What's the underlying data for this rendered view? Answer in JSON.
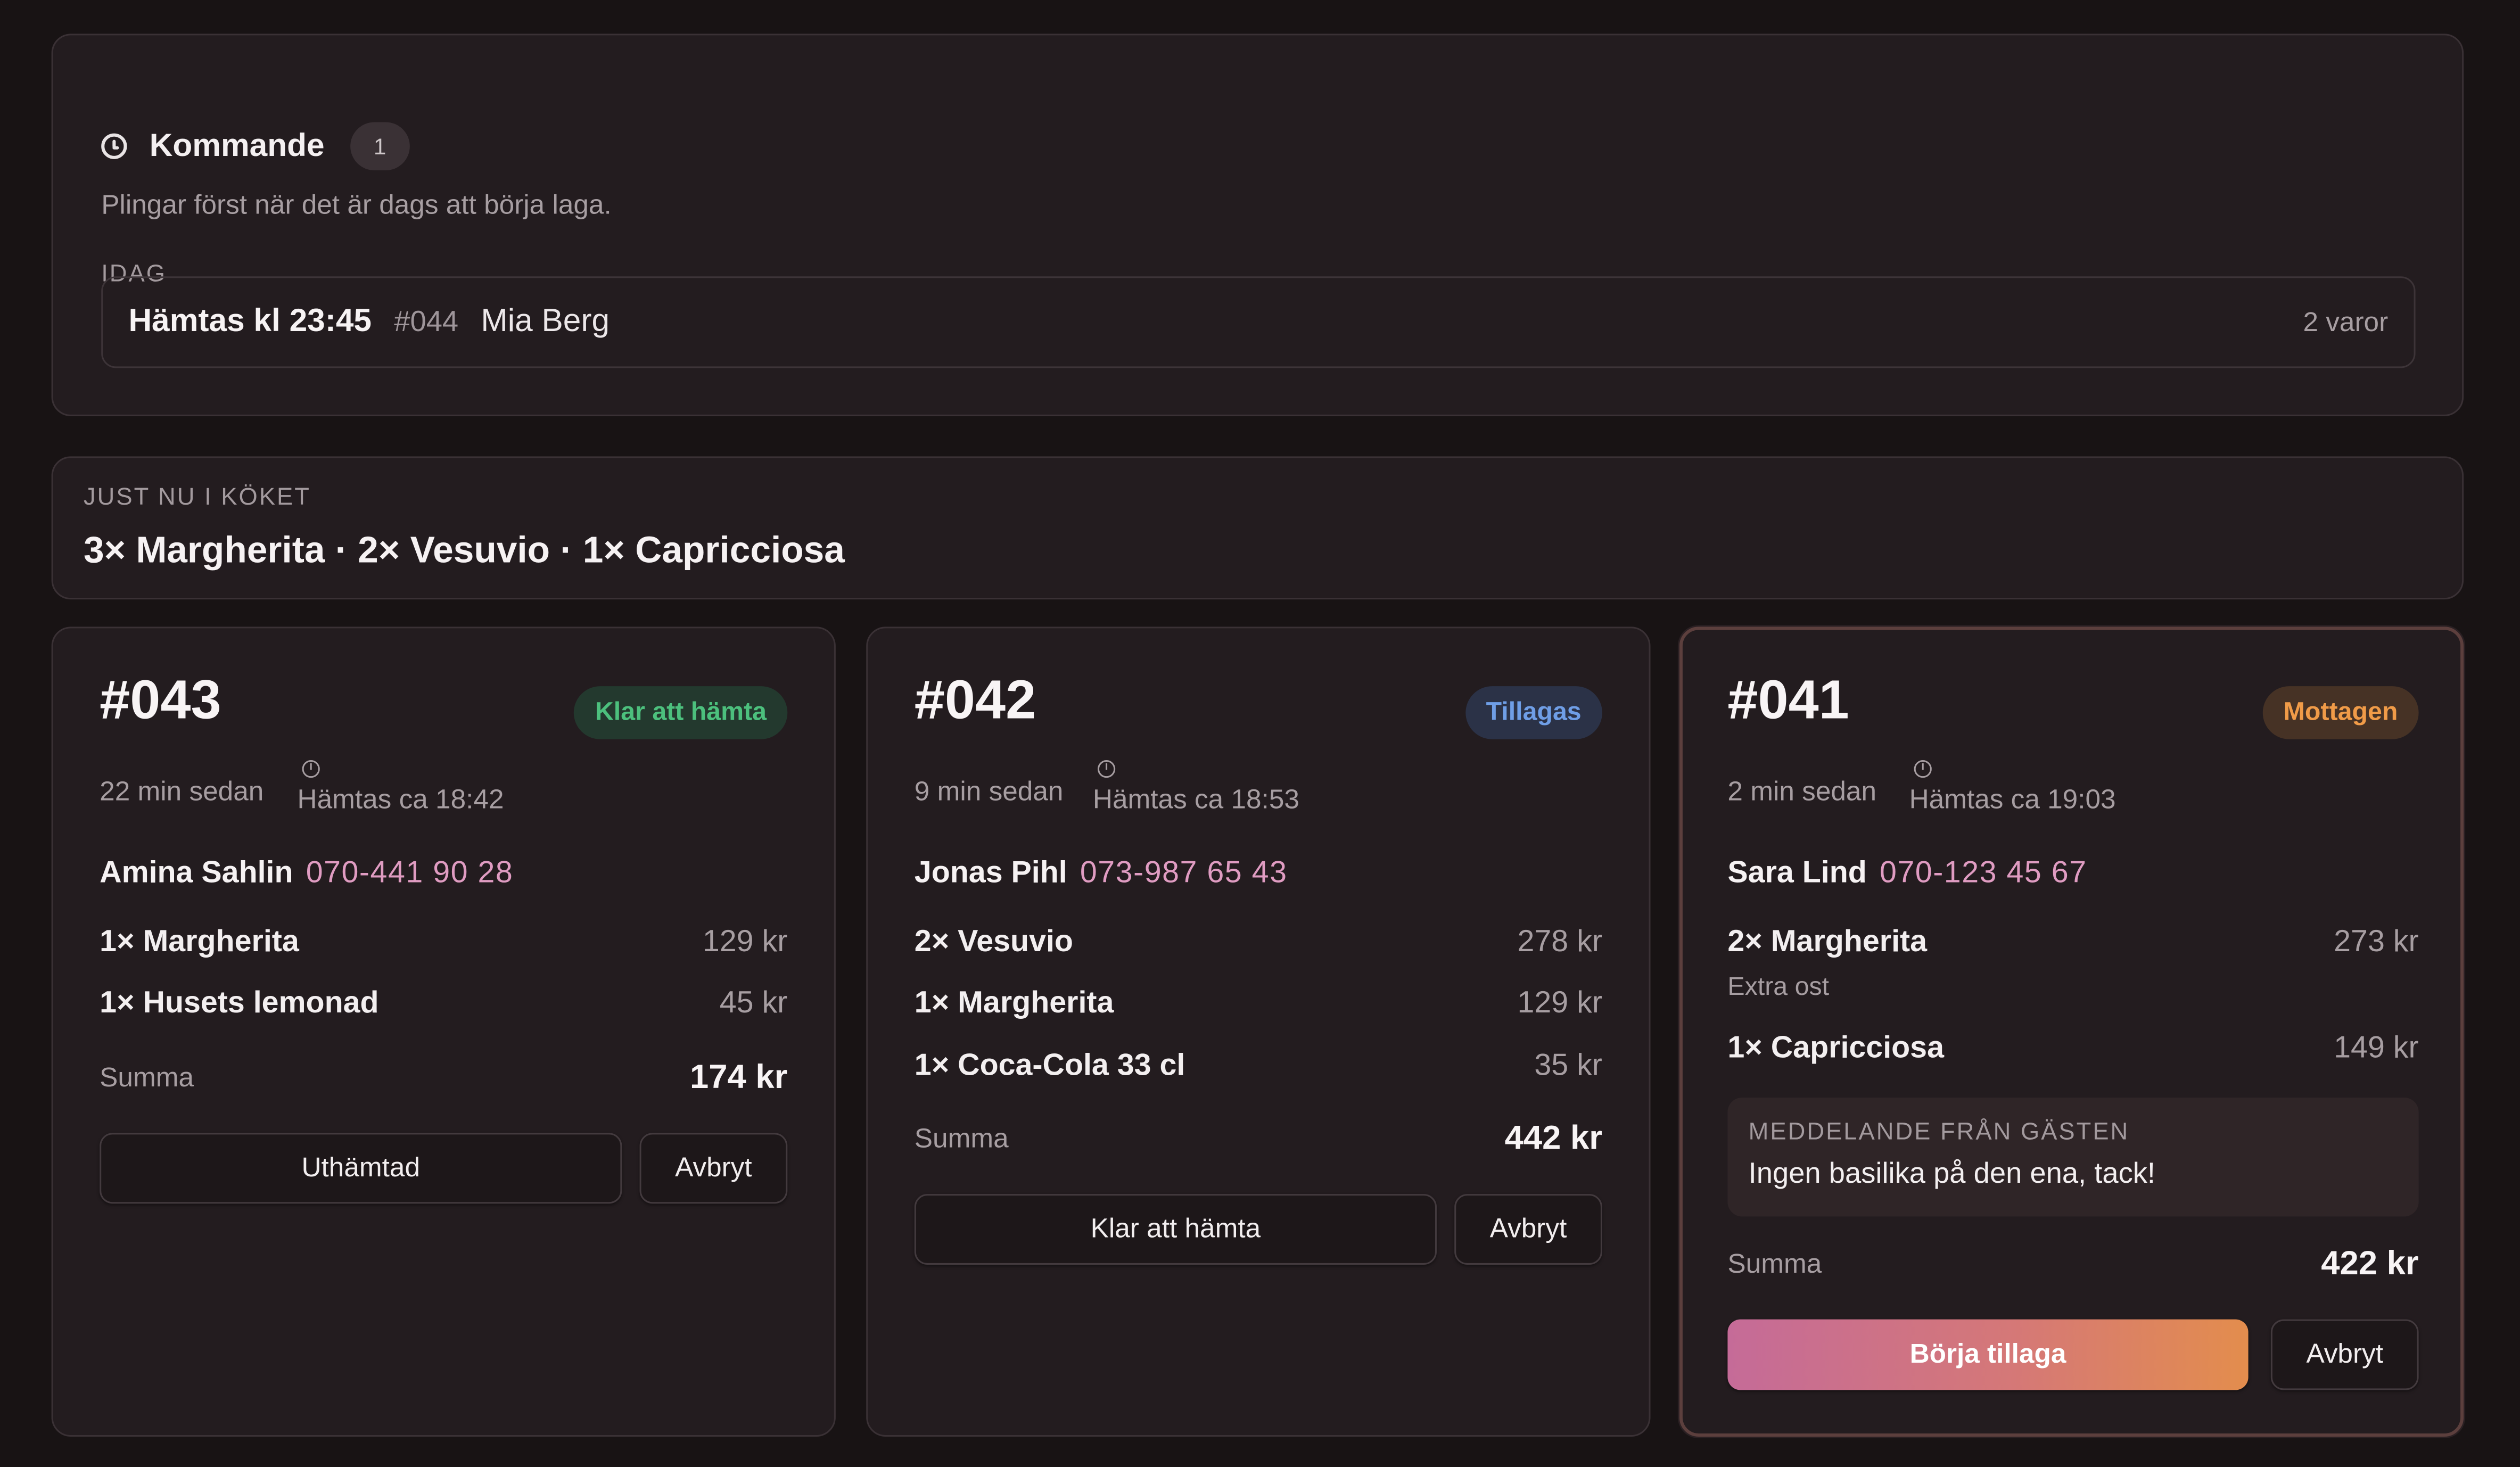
{
  "upcoming": {
    "title": "Kommande",
    "count": "1",
    "subtitle": "Plingar först när det är dags att börja laga.",
    "day_label": "IDAG",
    "orders": [
      {
        "pickup": "Hämtas kl 23:45",
        "id": "#044",
        "name": "Mia Berg",
        "items": "2 varor"
      }
    ]
  },
  "now_in_kitchen": {
    "label": "JUST NU I KÖKET",
    "summary": "3× Margherita · 2× Vesuvio · 1× Capricciosa"
  },
  "orders": [
    {
      "number": "#043",
      "status": "Klar att hämta",
      "status_color": "#4cc07d",
      "ago": "22 min sedan",
      "pickup": "Hämtas ca 18:42",
      "customer": "Amina Sahlin",
      "phone": "070-441 90 28",
      "items": [
        {
          "name": "1× Margherita",
          "price": "129 kr"
        },
        {
          "name": "1× Husets lemonad",
          "price": "45 kr"
        }
      ],
      "sum_label": "Summa",
      "sum": "174 kr",
      "primary_action": "Uthämtad",
      "cancel": "Avbryt"
    },
    {
      "number": "#042",
      "status": "Tillagas",
      "status_color": "#6f9ee6",
      "ago": "9 min sedan",
      "pickup": "Hämtas ca 18:53",
      "customer": "Jonas Pihl",
      "phone": "073-987 65 43",
      "items": [
        {
          "name": "2× Vesuvio",
          "price": "278 kr"
        },
        {
          "name": "1× Margherita",
          "price": "129 kr"
        },
        {
          "name": "1× Coca-Cola 33 cl",
          "price": "35 kr"
        }
      ],
      "sum_label": "Summa",
      "sum": "442 kr",
      "primary_action": "Klar att hämta",
      "cancel": "Avbryt"
    },
    {
      "number": "#041",
      "status": "Mottagen",
      "status_color": "#f09b48",
      "ago": "2 min sedan",
      "pickup": "Hämtas ca 19:03",
      "customer": "Sara Lind",
      "phone": "070-123 45 67",
      "items": [
        {
          "name": "2× Margherita",
          "price": "273 kr",
          "note": "Extra ost"
        },
        {
          "name": "1× Capricciosa",
          "price": "149 kr"
        }
      ],
      "message_label": "MEDDELANDE FRÅN GÄSTEN",
      "message": "Ingen basilika på den ena, tack!",
      "sum_label": "Summa",
      "sum": "422 kr",
      "primary_action": "Börja tillaga",
      "cancel": "Avbryt"
    }
  ]
}
